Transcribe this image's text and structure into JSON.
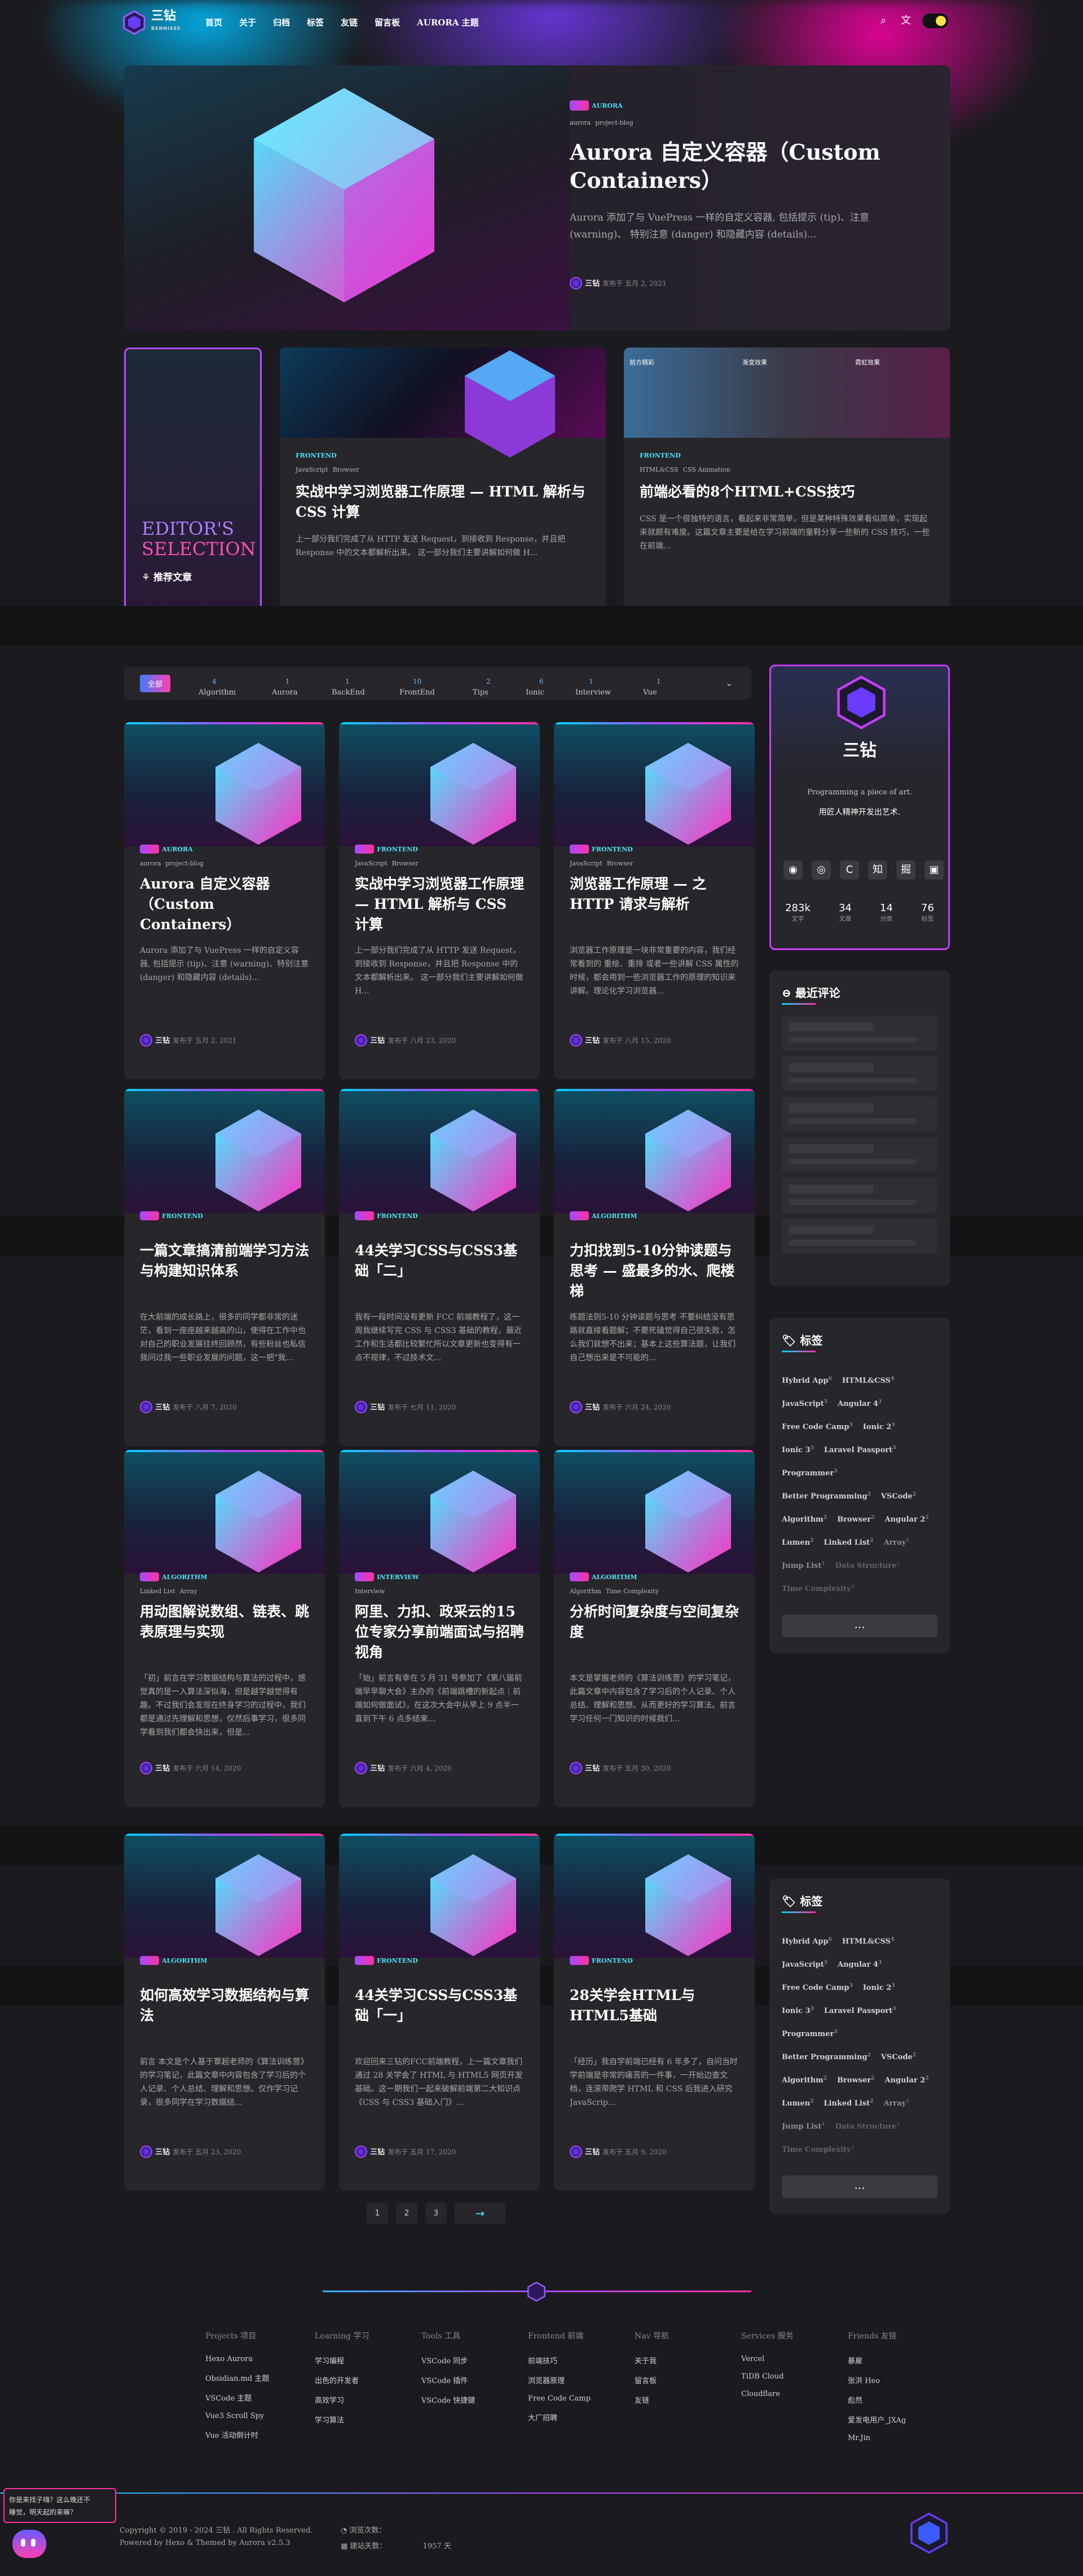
{
  "brand": {
    "name": "三钻",
    "sub": "BENNISSS"
  },
  "nav": {
    "links": [
      "首页",
      "关于",
      "归档",
      "标签",
      "友链",
      "留言板",
      "AURORA 主题"
    ]
  },
  "hero": {
    "category": "AURORA",
    "tags": [
      "aurora",
      "project-blog"
    ],
    "title": "Aurora 自定义容器（Custom Containers）",
    "desc": "Aurora 添加了与 VuePress 一样的自定义容器, 包括提示 (tip)、注意 (warning)、 特别注意 (danger) 和隐藏内容 (details)...",
    "author": "三钻",
    "date": "发布于 五月 2, 2021"
  },
  "editors": {
    "title1": "EDITOR'S",
    "title2": "SELECTION",
    "sub": "推荐文章"
  },
  "feat": [
    {
      "category": "FRONTEND",
      "tags": [
        "JavaScript",
        "Browser"
      ],
      "title": "实战中学习浏览器工作原理 — HTML 解析与 CSS 计算",
      "desc": "上一部分我们完成了从 HTTP 发送 Request，到接收到 Response，并且把 Response 中的文本都解析出来。 这一部分我们主要讲解如何做 H..."
    },
    {
      "category": "FRONTEND",
      "tags": [
        "HTML&CSS",
        "CSS Animation"
      ],
      "title": "前端必看的8个HTML+CSS技巧",
      "desc": "CSS 是一个很独特的语言，看起来非常简单，但是某种特殊效果看似简单，实现起来就颇有难度。这篇文章主要是给在学习前端的童鞋分享一些新的 CSS 技巧，一些在前端...",
      "img_labels": [
        "前方精彩",
        "渐变效果",
        "霓虹效果"
      ]
    }
  ],
  "filter": {
    "items": [
      {
        "l": "全部",
        "c": ""
      },
      {
        "l": "Algorithm",
        "c": "4"
      },
      {
        "l": "Aurora",
        "c": "1"
      },
      {
        "l": "BackEnd",
        "c": "1"
      },
      {
        "l": "FrontEnd",
        "c": "10"
      },
      {
        "l": "Tips",
        "c": "2"
      },
      {
        "l": "Ionic",
        "c": "6"
      },
      {
        "l": "Interview",
        "c": "1"
      },
      {
        "l": "Vue",
        "c": "1"
      }
    ]
  },
  "posts": [
    {
      "category": "AURORA",
      "tags": [
        "aurora",
        "project-blog"
      ],
      "title": "Aurora 自定义容器（Custom Containers）",
      "desc": "Aurora 添加了与 VuePress 一样的自定义容器, 包括提示 (tip)、注意 (warning)、特别注意 (danger) 和隐藏内容 (details)...",
      "date": "发布于 五月 2, 2021"
    },
    {
      "category": "FRONTEND",
      "tags": [
        "JavaScript",
        "Browser"
      ],
      "title": "实战中学习浏览器工作原理 — HTML 解析与 CSS 计算",
      "desc": "上一部分我们完成了从 HTTP 发送 Request，到接收到 Response，并且把 Response 中的文本都解析出来。 这一部分我们主要讲解如何做 H...",
      "date": "发布于 八月 23, 2020"
    },
    {
      "category": "FRONTEND",
      "tags": [
        "JavaScript",
        "Browser"
      ],
      "title": "浏览器工作原理 — 之 HTTP 请求与解析",
      "desc": "浏览器工作原理是一块非常重要的内容，我们经常看到的 重绘、重排 或者一些讲解 CSS 属性的时候，都会用到一些浏览器工作的原理的知识来讲解。理论化学习浏览器...",
      "date": "发布于 八月 15, 2020"
    },
    {
      "category": "FRONTEND",
      "tags": [],
      "title": "一篇文章搞清前端学习方法与构建知识体系",
      "desc": "在大前端的成长路上，很多的同学都非常的迷茫，看到一座座越来越高的山，使得在工作中也对自己的职业发展往终回顾然，有些粉丝也私信我问过我一些职业发展的问题，这一把\"我...",
      "date": "发布于 八月 7, 2020"
    },
    {
      "category": "FRONTEND",
      "tags": [],
      "title": "44关学习CSS与CSS3基础「二」",
      "desc": "我有一段时间没有更新 FCC 前端教程了，这一周我继续写完 CSS 与 CSS3 基础的教程，最近工作和生活都比较繁忙所以文章更新也变得有一点不规律，不过技术文...",
      "date": "发布于 七月 11, 2020"
    },
    {
      "category": "ALGORITHM",
      "tags": [],
      "title": "力扣找到5-10分钟读题与思考 — 盛最多的水、爬楼梯",
      "desc": "练题法则5-10 分钟读题与思考 不要纠结没有思路就直接看题解；不要死磕觉得自己很失败，怎么我们就想不出来；基本上这些算法题，让我们自己想出来是不可能的...",
      "date": "发布于 六月 24, 2020"
    },
    {
      "category": "ALGORITHM",
      "tags": [
        "Linked List",
        "Array"
      ],
      "title": "用动图解说数组、链表、跳表原理与实现",
      "desc": "「初」前言在学习数据结构与算法的过程中，感觉真的是一入算法深似海，但是越学越觉得有趣。不过我们会发现在终身学习的过程中，我们都是通过先理解和思想，仅然后事学习，很多同学看到我们都会快出来，但是...",
      "date": "发布于 六月 14, 2020"
    },
    {
      "category": "INTERVIEW",
      "tags": [
        "Interview"
      ],
      "title": "阿里、力扣、政采云的15位专家分享前端面试与招聘视角",
      "desc": "「始」前言有幸在 5 月 31 号参加了《第八届前端早早聊大会》主办的《前端跳槽的新起点｜前端如何做面试》，在这次大会中从早上 9 点半一直到下午 6 点多结束...",
      "date": "发布于 六月 4, 2020"
    },
    {
      "category": "ALGORITHM",
      "tags": [
        "Algorithm",
        "Time Complexity"
      ],
      "title": "分析时间复杂度与空间复杂度",
      "desc": "本文是掌握老师的《算法训练营》的学习笔记，此篇文章中内容包含了学习后的个人记录、个人总结、理解和思想。从而更好的学习算法。前言学习任何一门知识的时候我们...",
      "date": "发布于 五月 30, 2020"
    },
    {
      "category": "ALGORITHM",
      "tags": [],
      "title": "如何高效学习数据结构与算法",
      "desc": "前言 本文是个人基于覃超老师的《算法训练营》的学习笔记，此篇文章中内容包含了学习后的个人记录、个人总结、理解和思想。仅作学习记录，很多同学在学习数据结...",
      "date": "发布于 五月 23, 2020"
    },
    {
      "category": "FRONTEND",
      "tags": [],
      "title": "44关学习CSS与CSS3基础「一」",
      "desc": "欢迎回来三钻的FCC前端教程，上一篇文章我们通过 28 关学会了 HTML 与 HTML5 网页开发基础。这一期我们一起来破解前端第二大知识点《CSS 与 CSS3 基础入门》...",
      "date": "发布于 五月 17, 2020"
    },
    {
      "category": "FRONTEND",
      "tags": [],
      "title": "28关学会HTML与HTML5基础",
      "desc": "「经历」我自学前端已经有 6 年多了，自问当时学前端是非常的痛苦的一件事，一开始边查文档，连滚带爬学 HTML 和 CSS 后我进入研究 JavaScrip...",
      "date": "发布于 五月 9, 2020"
    }
  ],
  "profile": {
    "name": "三钻",
    "slogan1": "Programming a piece of art.",
    "slogan2": "用匠人精神开发出艺术.",
    "stats": [
      {
        "n": "283k",
        "l": "文字"
      },
      {
        "n": "34",
        "l": "文章"
      },
      {
        "n": "14",
        "l": "分类"
      },
      {
        "n": "76",
        "l": "标签"
      }
    ]
  },
  "comments_title": "最近评论",
  "tags_title": "标签",
  "tagcloud": [
    {
      "t": "Hybrid App",
      "c": "6"
    },
    {
      "t": "HTML&CSS",
      "c": "4"
    },
    {
      "t": "JavaScript",
      "c": "5"
    },
    {
      "t": "Angular 4",
      "c": "3"
    },
    {
      "t": "Free Code Camp",
      "c": "3"
    },
    {
      "t": "Ionic 2",
      "c": "3"
    },
    {
      "t": "Ionic 3",
      "c": "3"
    },
    {
      "t": "Laravel Passport",
      "c": "3"
    },
    {
      "t": "Programmer",
      "c": "3"
    },
    {
      "t": "Better Programming",
      "c": "2"
    },
    {
      "t": "VSCode",
      "c": "2"
    },
    {
      "t": "Algorithm",
      "c": "2"
    },
    {
      "t": "Browser",
      "c": "2"
    },
    {
      "t": "Angular 2",
      "c": "2"
    },
    {
      "t": "Lumen",
      "c": "2"
    },
    {
      "t": "Linked List",
      "c": "2"
    },
    {
      "t": "Array",
      "c": "1"
    },
    {
      "t": "Jump List",
      "c": "1"
    },
    {
      "t": "Data Structure",
      "c": "1"
    },
    {
      "t": "Time Complexity",
      "c": "1"
    }
  ],
  "more": "...",
  "pagination": [
    "1",
    "2",
    "3",
    "→"
  ],
  "footer": {
    "cols": [
      {
        "h": "Projects 项目",
        "items": [
          "Hexo Aurora",
          "Obsidian.md 主题",
          "VSCode 主题",
          "Vue3 Scroll Spy",
          "Vue 活动倒计时"
        ]
      },
      {
        "h": "Learning 学习",
        "items": [
          "学习编程",
          "出色的开发者",
          "高效学习",
          "学习算法"
        ]
      },
      {
        "h": "Tools 工具",
        "items": [
          "VSCode 同步",
          "VSCode 插件",
          "VSCode 快捷键"
        ]
      },
      {
        "h": "Frontend 前端",
        "items": [
          "前端技巧",
          "浏览器原理",
          "Free Code Camp",
          "大厂招聘"
        ]
      },
      {
        "h": "Nav 导航",
        "items": [
          "关于我",
          "留言板",
          "友链"
        ]
      },
      {
        "h": "Services 服务",
        "items": [
          "Vercel",
          "TiDB Cloud",
          "Cloudflare"
        ]
      },
      {
        "h": "Friends 友链",
        "items": [
          "暴雇",
          "张洪 Heo",
          "彪然",
          "爱发电用户_JXAg",
          "Mr.Jin"
        ]
      }
    ],
    "copyright": "Copyright © 2019 - 2024 三钻 . All Rights Reserved.",
    "powered": "Powered by Hexo & Themed by Aurora v2.5.3",
    "visits": "浏览次数：",
    "days": "建站天数：",
    "days_val": "1957 天"
  },
  "bubble": {
    "line1": "你是来找子嗨？这么晚还不",
    "line2": "睡觉，明天起的来嘛？"
  }
}
